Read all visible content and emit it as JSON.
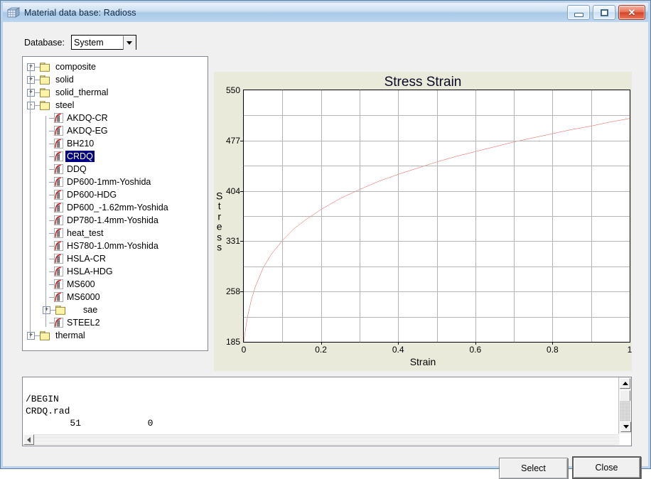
{
  "window": {
    "title": "Material data base: Radioss",
    "icon": "material-grid-icon",
    "controls": {
      "minimize": "minimize-button",
      "maximize": "maximize-button",
      "close": "close-button",
      "close_glyph": "✕"
    }
  },
  "toolbar": {
    "database_label": "Database:",
    "database_value": "System",
    "database_options": [
      "System"
    ]
  },
  "tree": {
    "items": [
      {
        "label": "composite",
        "type": "folder",
        "level": 0,
        "toggle": "+"
      },
      {
        "label": "solid",
        "type": "folder",
        "level": 0,
        "toggle": "+"
      },
      {
        "label": "solid_thermal",
        "type": "folder",
        "level": 0,
        "toggle": "+"
      },
      {
        "label": "steel",
        "type": "folder",
        "level": 0,
        "toggle": "-"
      },
      {
        "label": "AKDQ-CR",
        "type": "material",
        "level": 1,
        "toggle": ""
      },
      {
        "label": "AKDQ-EG",
        "type": "material",
        "level": 1,
        "toggle": ""
      },
      {
        "label": "BH210",
        "type": "material",
        "level": 1,
        "toggle": ""
      },
      {
        "label": "CRDQ",
        "type": "material",
        "level": 1,
        "toggle": "",
        "selected": true
      },
      {
        "label": "DDQ",
        "type": "material",
        "level": 1,
        "toggle": ""
      },
      {
        "label": "DP600-1mm-Yoshida",
        "type": "material",
        "level": 1,
        "toggle": ""
      },
      {
        "label": "DP600-HDG",
        "type": "material",
        "level": 1,
        "toggle": ""
      },
      {
        "label": "DP600_-1.62mm-Yoshida",
        "type": "material",
        "level": 1,
        "toggle": ""
      },
      {
        "label": "DP780-1.4mm-Yoshida",
        "type": "material",
        "level": 1,
        "toggle": ""
      },
      {
        "label": "heat_test",
        "type": "material",
        "level": 1,
        "toggle": ""
      },
      {
        "label": "HS780-1.0mm-Yoshida",
        "type": "material",
        "level": 1,
        "toggle": ""
      },
      {
        "label": "HSLA-CR",
        "type": "material",
        "level": 1,
        "toggle": ""
      },
      {
        "label": "HSLA-HDG",
        "type": "material",
        "level": 1,
        "toggle": ""
      },
      {
        "label": "MS600",
        "type": "material",
        "level": 1,
        "toggle": ""
      },
      {
        "label": "MS6000",
        "type": "material",
        "level": 1,
        "toggle": ""
      },
      {
        "label": "sae",
        "type": "folder",
        "level": 1,
        "toggle": "+"
      },
      {
        "label": "STEEL2",
        "type": "material",
        "level": 1,
        "toggle": ""
      },
      {
        "label": "thermal",
        "type": "folder",
        "level": 0,
        "toggle": "+"
      }
    ]
  },
  "chart_data": {
    "type": "line",
    "title": "Stress Strain",
    "xlabel": "Strain",
    "ylabel": "Stress",
    "xlim": [
      0,
      1
    ],
    "ylim": [
      185,
      550
    ],
    "xticks": [
      "0",
      "0.2",
      "0.4",
      "0.6",
      "0.8",
      "1"
    ],
    "xtick_values": [
      0,
      0.2,
      0.4,
      0.6,
      0.8,
      1
    ],
    "yticks": [
      "185",
      "258",
      "331",
      "404",
      "477",
      "550"
    ],
    "ytick_values": [
      185,
      258,
      331,
      404,
      477,
      550
    ],
    "grid": true,
    "legend": "none",
    "line_color": "#dd0000",
    "background": "#eaeada",
    "plot_background": "#ffffff",
    "series": [
      {
        "name": "CRDQ",
        "x": [
          0,
          0.005,
          0.01,
          0.02,
          0.03,
          0.05,
          0.07,
          0.1,
          0.13,
          0.16,
          0.2,
          0.25,
          0.3,
          0.35,
          0.4,
          0.45,
          0.5,
          0.55,
          0.6,
          0.65,
          0.7,
          0.75,
          0.8,
          0.85,
          0.9,
          0.95,
          1.0
        ],
        "y": [
          185,
          205,
          222,
          247,
          265,
          292,
          311,
          332,
          349,
          362,
          377,
          393,
          406,
          418,
          428,
          437,
          446,
          454,
          461,
          468,
          475,
          481,
          487,
          493,
          498,
          504,
          509
        ]
      }
    ]
  },
  "output": {
    "lines": [
      "/BEGIN",
      "CRDQ.rad",
      "        51            0"
    ]
  },
  "buttons": {
    "select": "Select",
    "close": "Close"
  }
}
